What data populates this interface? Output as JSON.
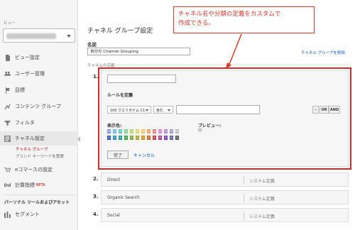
{
  "sidebar": {
    "view_label": "ビュー",
    "items": [
      {
        "label": "ビュー設定",
        "icon": "document-icon"
      },
      {
        "label": "ユーザー管理",
        "icon": "users-icon"
      },
      {
        "label": "目標",
        "icon": "flag-icon"
      },
      {
        "label": "コンテンツ グループ",
        "icon": "content-group-icon"
      },
      {
        "label": "フィルタ",
        "icon": "filter-icon"
      },
      {
        "label": "チャネル設定",
        "icon": "channel-settings-icon"
      },
      {
        "label": "eコマースの設定",
        "icon": "cart-icon"
      },
      {
        "label": "計算指標",
        "icon": "dd-icon",
        "icon_text": "Dd",
        "badge": "BETA"
      }
    ],
    "channel_sub": {
      "current": "チャネル グループ",
      "other": "ブランド キーワードを管理"
    },
    "section_head": "パーソナル ツールおよびアセット",
    "segment": {
      "label": "セグメント",
      "icon": "segment-icon"
    }
  },
  "callout": {
    "line1": "チャネル名や分類の定義をカスタムで",
    "line2": "作成できる。"
  },
  "main": {
    "title": "チャネル グループ設定",
    "name_label": "名前",
    "name_value": "自分の Channel Grouping",
    "delete_link": "チャネル グループを削除",
    "defs_label": "チャネルの定義"
  },
  "editor": {
    "row_number": "1.",
    "channel_name_value": "",
    "rule_title": "ルールを定義",
    "dimension": "100 クエリタイム C1",
    "operator": "含む",
    "value": "",
    "minus_button": "-",
    "or_button": "OR",
    "and_button": "AND",
    "color_label": "表示色:",
    "preview_label": "プレビュー:",
    "swatch_top": [
      "#7b9ad6",
      "#6cb9e6",
      "#5fc5c7",
      "#7fcf8a",
      "#b5d66a",
      "#d6d66a",
      "#efc66a",
      "#ee9f6a",
      "#e27f7f",
      "#d68ac2",
      "#b98ad6",
      "#9c9ccf",
      "#bdbdbd"
    ],
    "swatch_bottom": [
      "#2f55b4",
      "#1f8bc9",
      "#1b9c9e",
      "#33a348",
      "#7ba52a",
      "#a8a22a",
      "#d08f16",
      "#cf5e1f",
      "#c23a3a",
      "#b03a8f",
      "#7b3ab0",
      "#5b5ba8",
      "#555555"
    ],
    "swatch_char": "a",
    "done_button": "完了",
    "cancel_link": "キャンセル"
  },
  "channels": [
    {
      "num": "2.",
      "name": "Direct",
      "type": "システム定義"
    },
    {
      "num": "3.",
      "name": "Organic Search",
      "type": "システム定義"
    },
    {
      "num": "4.",
      "name": "Social",
      "type": "システム定義"
    }
  ],
  "colors": {
    "accent_red": "#d63a2a",
    "link_blue": "#1155cc",
    "active_red": "#cc0000"
  }
}
